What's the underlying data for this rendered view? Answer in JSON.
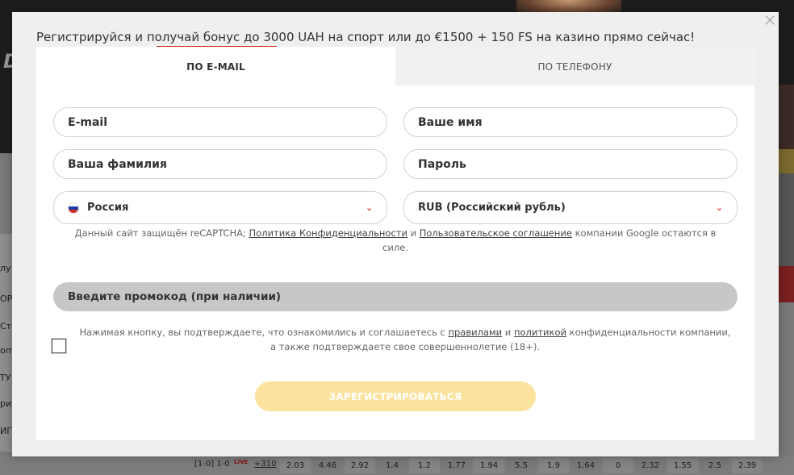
{
  "modal": {
    "headline": "Регистрируйся и получай бонус до 3000 UAH на спорт или до €1500 + 150 FS на казино прямо сейчас!",
    "tabs": [
      {
        "label": "ПО E-MAIL",
        "active": true
      },
      {
        "label": "ПО ТЕЛЕФОНУ",
        "active": false
      }
    ],
    "fields": {
      "email_placeholder": "E-mail",
      "first_name_placeholder": "Ваше имя",
      "last_name_placeholder": "Ваша фамилия",
      "password_placeholder": "Пароль",
      "country_value": "Россия",
      "currency_value": "RUB (Российский рубль)"
    },
    "recaptcha": {
      "prefix": "Данный сайт защищён reCAPTCHA; ",
      "privacy_link": "Политика Конфиденциальности",
      "and": " и ",
      "terms_link": "Пользовательское соглашение",
      "suffix": " компании Google остаются в силе."
    },
    "promo_label": "Введите промокод (при наличии)",
    "terms": {
      "prefix": "Нажимая кнопку, вы подтверждаете, что ознакомились и соглашаетесь с ",
      "rules_link": "правилами",
      "and": " и ",
      "policy_link": "политикой",
      "suffix": " конфиденциальности компании, а также подтверждаете свое совершеннолетие (18+)."
    },
    "register_label": "ЗАРЕГИСТРИРОВАТЬСЯ",
    "close_glyph": "×"
  },
  "background": {
    "left_menu": [
      "лу",
      "OPE",
      "Ста",
      "om",
      "ТУ",
      "рил",
      "ИГ"
    ],
    "odds_row": {
      "score": "[1-0] 1-0",
      "live": "LIVE",
      "plus": "+310",
      "values": [
        "2.03",
        "4.46",
        "2.92",
        "1.4",
        "1.2",
        "1.77",
        "1.94",
        "5.5",
        "1.9",
        "1.64",
        "0",
        "2.32",
        "1.55",
        "2.5",
        "2.39"
      ]
    }
  },
  "colors": {
    "accent_red": "#d32a1f",
    "register_button": "#fbe39e",
    "promo_background": "#c8c6c6"
  }
}
